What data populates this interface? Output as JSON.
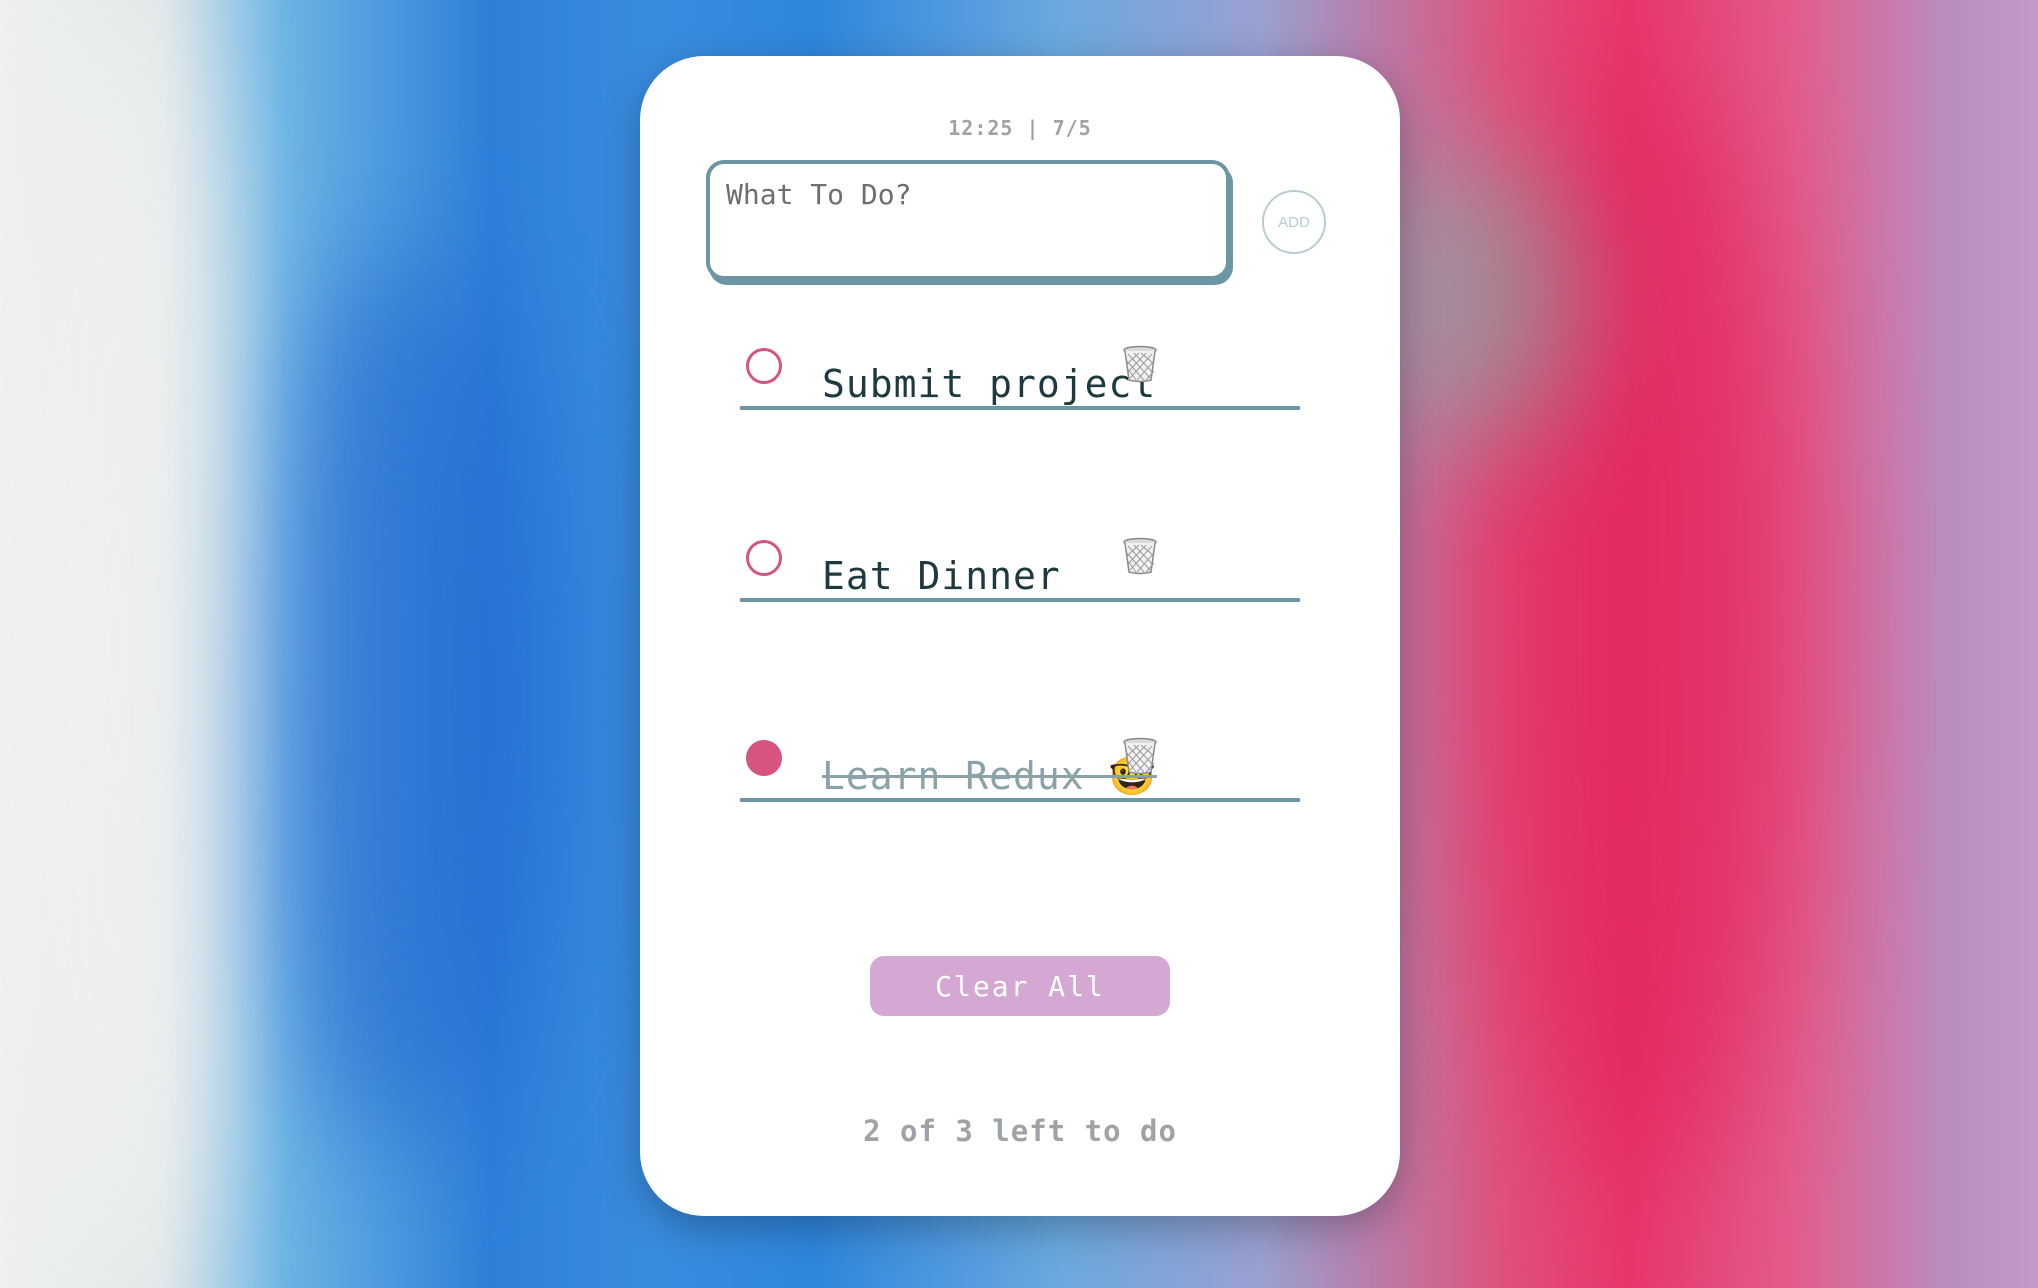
{
  "background": {
    "colors": [
      "#eef0ef",
      "#2f7fd9",
      "#e8366a",
      "#c39ac8"
    ]
  },
  "header": {
    "clock": "12:25 | 7/5"
  },
  "composer": {
    "placeholder": "What To Do?",
    "value": "",
    "add_label": "ADD"
  },
  "todos": [
    {
      "text": "Submit project",
      "done": false
    },
    {
      "text": "Eat Dinner",
      "done": false
    },
    {
      "text": "Learn Redux 🤓",
      "done": true
    }
  ],
  "icons": {
    "checkbox": "circle-checkbox-icon",
    "delete": "trash-can-icon"
  },
  "actions": {
    "clear_all_label": "Clear All"
  },
  "footer": {
    "remaining": "2 of 3 left to do"
  },
  "colors": {
    "accent_pink": "#d6547f",
    "border_teal": "#6a97a3",
    "clear_button": "#d4a8d2",
    "muted_text": "#9fa3a6"
  }
}
